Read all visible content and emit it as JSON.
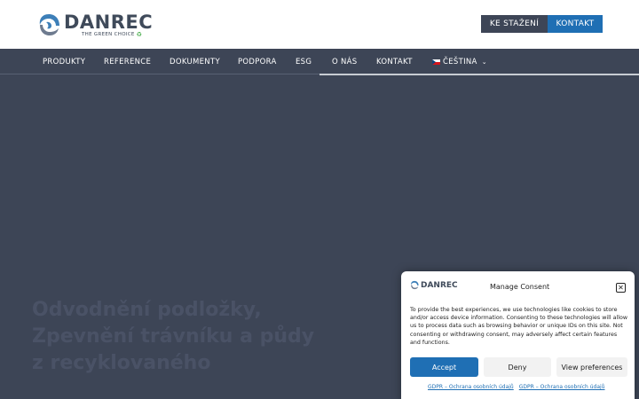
{
  "header": {
    "logo_name": "DANREC",
    "logo_tagline": "THE GREEN CHOICE",
    "download_button": "KE STAŽENÍ",
    "contact_button": "KONTAKT"
  },
  "nav": {
    "items": [
      {
        "label": "PRODUKTY"
      },
      {
        "label": "REFERENCE"
      },
      {
        "label": "DOKUMENTY"
      },
      {
        "label": "PODPORA"
      },
      {
        "label": "ESG"
      },
      {
        "label": "O NÁS"
      },
      {
        "label": "KONTAKT"
      },
      {
        "label": "ČEŠTINA"
      }
    ]
  },
  "hero": {
    "title": "Odvodnění podložky, Zpevnění trávníku a půdy z recyklovaného"
  },
  "consent": {
    "logo_name": "DANREC",
    "title": "Manage Consent",
    "close": "✕",
    "text": "To provide the best experiences, we use technologies like cookies to store and/or access device information. Consenting to these technologies will allow us to process data such as browsing behavior or unique IDs on this site. Not consenting or withdrawing consent, may adversely affect certain features and functions.",
    "accept": "Accept",
    "deny": "Deny",
    "preferences": "View preferences",
    "links": [
      "GDPR – Ochrana osobních údajů",
      "GDPR – Ochrana osobních údajů"
    ]
  },
  "colors": {
    "dark": "#3d4556",
    "brand_blue": "#1f6fb4",
    "logo_text": "#3f4a5a"
  }
}
